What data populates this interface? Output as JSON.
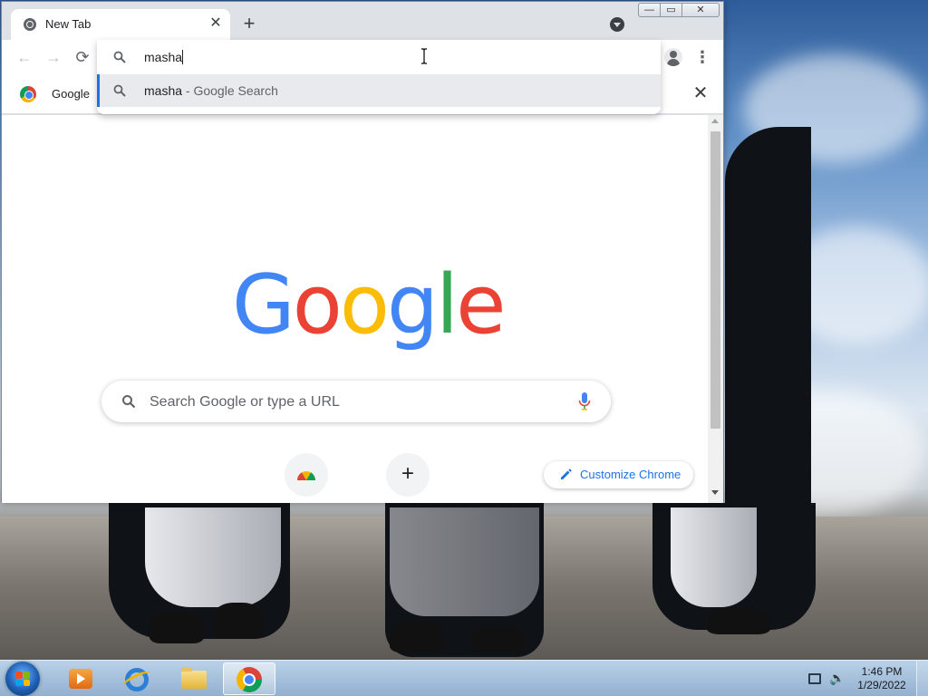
{
  "window": {
    "tab_title": "New Tab",
    "tab_close": "✕",
    "new_tab": "+",
    "win_minimize": "—",
    "win_maximize": "▭",
    "win_close": "✕"
  },
  "toolbar": {
    "back": "←",
    "forward": "→",
    "reload": "⟳",
    "menu": "⋮"
  },
  "omnibox": {
    "input_value": "masha",
    "suggestion_query": "masha",
    "suggestion_desc": " - Google Search"
  },
  "bookmarks": {
    "item_label": "Google Chrome",
    "close": "✕"
  },
  "ntp": {
    "logo_letters": [
      {
        "char": "G",
        "color": "#4285f4"
      },
      {
        "char": "o",
        "color": "#ea4335"
      },
      {
        "char": "o",
        "color": "#fbbc05"
      },
      {
        "char": "g",
        "color": "#4285f4"
      },
      {
        "char": "l",
        "color": "#34a853"
      },
      {
        "char": "e",
        "color": "#ea4335"
      }
    ],
    "search_placeholder": "Search Google or type a URL",
    "add_shortcut": "+",
    "customize_label": "Customize Chrome"
  },
  "taskbar": {
    "time": "1:46 PM",
    "date": "1/29/2022",
    "volume_icon": "🔈"
  },
  "colors": {
    "accent": "#1a73e8",
    "tab_strip": "#dee1e6"
  }
}
